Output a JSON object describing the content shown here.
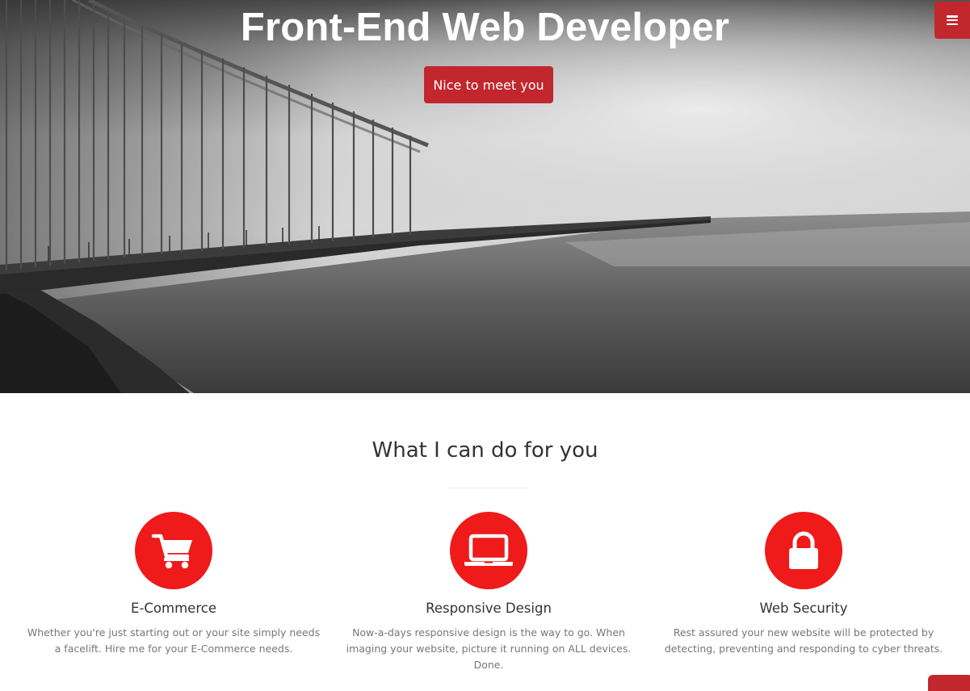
{
  "hero": {
    "title": "Front-End Web Developer",
    "cta_label": "Nice to meet you",
    "menu_icon": "bars-icon",
    "background_image": "foggy-suspension-bridge-photo"
  },
  "services": {
    "heading": "What I can do for you",
    "items": [
      {
        "icon": "shopping-cart-icon",
        "title": "E-Commerce",
        "text": "Whether you're just starting out or your site simply needs a facelift. Hire me for your E-Commerce needs."
      },
      {
        "icon": "laptop-icon",
        "title": "Responsive Design",
        "text": "Now-a-days responsive design is the way to go. When imaging your website, picture it running on ALL devices. Done."
      },
      {
        "icon": "lock-icon",
        "title": "Web Security",
        "text": "Rest assured your new website will be protected by detecting, preventing and responding to cyber threats."
      }
    ]
  },
  "colors": {
    "accent": "#c1272d",
    "icon_circle": "#ef1a1a",
    "heading_text": "#333333",
    "body_text": "#777777"
  },
  "scroll_top_icon": "scroll-top-icon"
}
